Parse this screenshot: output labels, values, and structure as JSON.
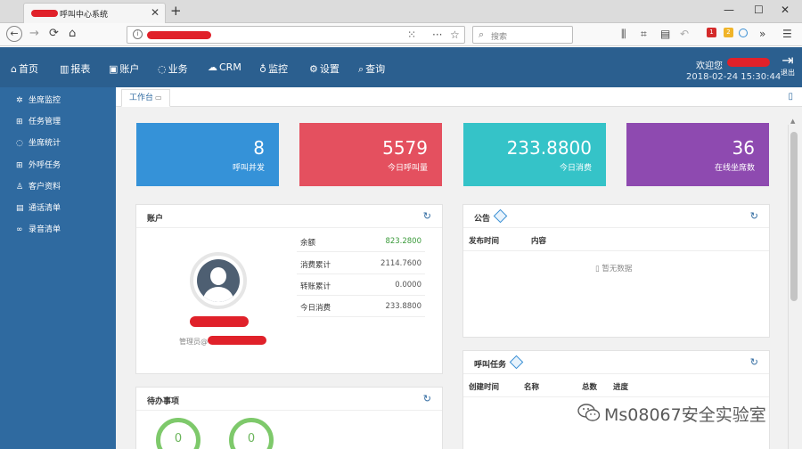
{
  "browser": {
    "tab_title": "呼叫中心系统",
    "tab_close": "✕",
    "new_tab": "+",
    "window_controls": [
      "—",
      "☐",
      "✕"
    ],
    "back": "←",
    "forward": "→",
    "reload": "⟳",
    "home": "⌂",
    "search_placeholder": "搜索",
    "url_actions": [
      "⁙",
      "···",
      "☆"
    ],
    "toolbar_icons": [
      "⫼",
      "⌗",
      "▤",
      "↶",
      "»",
      "☰"
    ],
    "badge_red": "1",
    "badge_yellow": "2"
  },
  "header": {
    "menu": [
      {
        "icon": "⌂",
        "label": "首页"
      },
      {
        "icon": "▥",
        "label": "报表"
      },
      {
        "icon": "▣",
        "label": "账户"
      },
      {
        "icon": "◌",
        "label": "业务"
      },
      {
        "icon": "☁",
        "label": "CRM"
      },
      {
        "icon": "♁",
        "label": "监控"
      },
      {
        "icon": "⚙",
        "label": "设置"
      },
      {
        "icon": "⌕",
        "label": "查询"
      }
    ],
    "welcome": "欢迎您",
    "datetime": "2018-02-24 15:30:44",
    "logout_label": "退出",
    "logout_icon": "⇥"
  },
  "sidebar": {
    "items": [
      {
        "icon": "✲",
        "label": "坐席监控"
      },
      {
        "icon": "⊞",
        "label": "任务管理"
      },
      {
        "icon": "◌",
        "label": "坐席统计"
      },
      {
        "icon": "⊞",
        "label": "外呼任务"
      },
      {
        "icon": "♙",
        "label": "客户资料"
      },
      {
        "icon": "▤",
        "label": "通话清单"
      },
      {
        "icon": "∞",
        "label": "录音清单"
      }
    ]
  },
  "content": {
    "tab_label": "工作台",
    "tab_icon": "▭",
    "tab_right_icon": "▯",
    "stats": [
      {
        "value": "8",
        "label": "呼叫并发",
        "color": "#3592d8"
      },
      {
        "value": "5579",
        "label": "今日呼叫量",
        "color": "#e4505f"
      },
      {
        "value": "233.8800",
        "label": "今日消费",
        "color": "#35c3c8"
      },
      {
        "value": "36",
        "label": "在线坐席数",
        "color": "#8e4ab0"
      }
    ],
    "account": {
      "title": "账户",
      "admin_label": "管理员@",
      "rows": [
        {
          "key": "余额",
          "value": "823.2800"
        },
        {
          "key": "消费累计",
          "value": "2114.7600"
        },
        {
          "key": "转账累计",
          "value": "0.0000"
        },
        {
          "key": "今日消费",
          "value": "233.8800"
        }
      ]
    },
    "notice": {
      "title": "公告",
      "col_time": "发布时间",
      "col_content": "内容",
      "empty": "暂无数据",
      "empty_icon": "▯"
    },
    "call_task": {
      "title": "呼叫任务",
      "cols": [
        "创建时间",
        "名称",
        "总数",
        "进度"
      ]
    },
    "todo": {
      "title": "待办事项",
      "values": [
        "0",
        "0"
      ]
    },
    "refresh_icon": "↻",
    "watermark": "Ms08067安全实验室"
  }
}
